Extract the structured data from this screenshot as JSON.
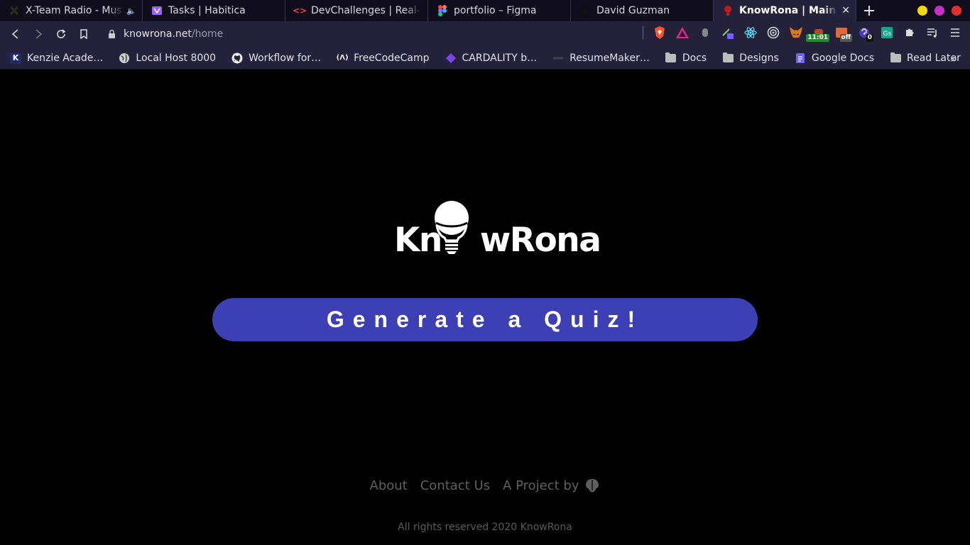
{
  "browser": {
    "tabs": [
      {
        "title": "X-Team Radio - Music",
        "icon": "x-team-icon",
        "audio": true
      },
      {
        "title": "Tasks | Habitica",
        "icon": "habitica-icon"
      },
      {
        "title": "DevChallenges | Real-life",
        "icon": "devchallenges-icon"
      },
      {
        "title": "portfolio – Figma",
        "icon": "figma-icon"
      },
      {
        "title": "David Guzman",
        "icon": "vercel-icon"
      },
      {
        "title": "KnowRona | Main Me",
        "icon": "knowrona-icon",
        "active": true
      }
    ],
    "new_tab_label": "+",
    "url_host": "knowrona.net",
    "url_path": "/home",
    "extension_badges": {
      "timer": "11:01",
      "pdf": "off",
      "count": "0"
    },
    "bookmarks": [
      {
        "label": "Kenzie Acade…",
        "icon": "kenzie-icon"
      },
      {
        "label": "Local Host 8000",
        "icon": "globe-icon"
      },
      {
        "label": "Workflow for…",
        "icon": "github-icon"
      },
      {
        "label": "FreeCodeCamp",
        "icon": "freecodecamp-icon"
      },
      {
        "label": "CARDALITY b…",
        "icon": "cardality-icon"
      },
      {
        "label": "ResumeMaker…",
        "icon": "resume-icon"
      },
      {
        "label": "Docs",
        "icon": "folder-icon"
      },
      {
        "label": "Designs",
        "icon": "folder-icon"
      },
      {
        "label": "Google Docs",
        "icon": "google-docs-icon"
      },
      {
        "label": "Read Later",
        "icon": "folder-icon"
      }
    ],
    "bookmarks_overflow": "»"
  },
  "page": {
    "logo": {
      "left": "Kn",
      "right": "wRona"
    },
    "cta_label": "Generate a Quiz!",
    "footer": {
      "about": "About",
      "contact": "Contact Us",
      "project_by": "A Project by"
    },
    "copyright": "All rights reserved 2020 KnowRona"
  },
  "colors": {
    "background": "#000000",
    "button": "#3c40b4",
    "browser_chrome": "#24213a",
    "footer_text": "#5f5f5f"
  }
}
